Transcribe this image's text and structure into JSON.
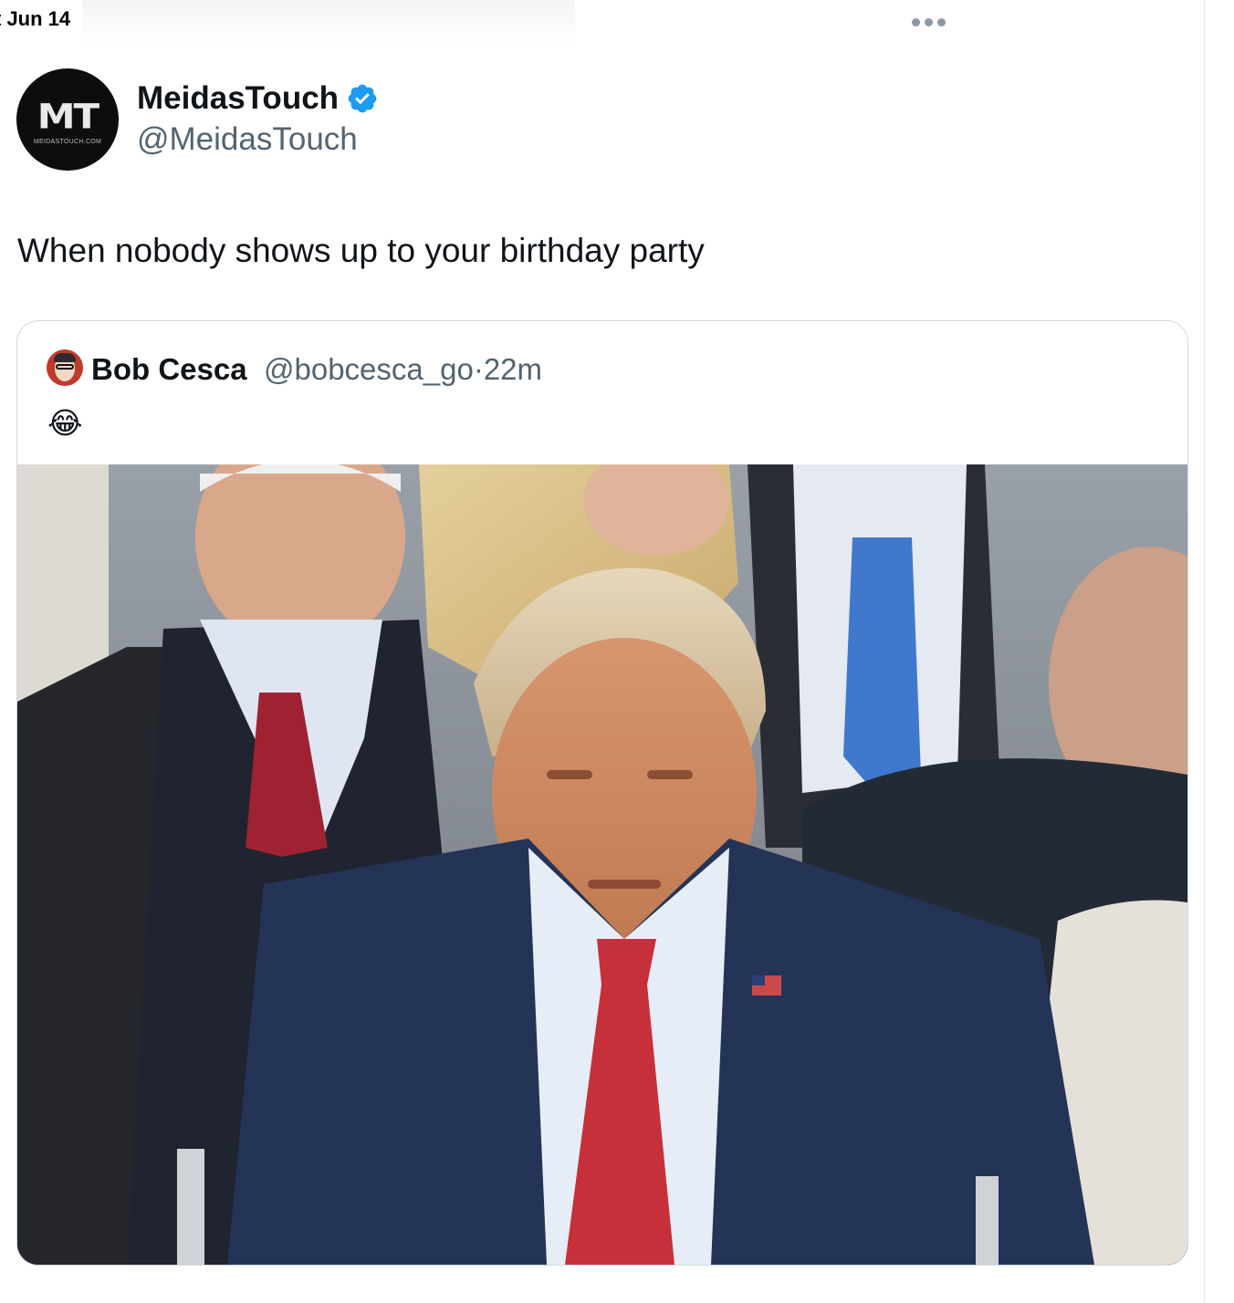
{
  "status_bar": {
    "date": "t Jun 14"
  },
  "post": {
    "author": {
      "display_name": "MeidasTouch",
      "handle": "@MeidasTouch",
      "verified": true,
      "avatar_monogram": "MT",
      "avatar_site_text": "MEIDASTOUCH.COM"
    },
    "text": "When nobody shows up to your birthday party",
    "more_icon": "more-horizontal-icon"
  },
  "quoted_post": {
    "author": {
      "display_name": "Bob Cesca",
      "handle": "@bobcesca_go",
      "separator": "·",
      "time": "22m"
    },
    "text": "😂",
    "media": "photo of Donald Trump in a navy suit and red tie seated at an outdoor event, with other attendees around him"
  },
  "colors": {
    "text_primary": "#0f1419",
    "text_secondary": "#536471",
    "verified_blue": "#1d9bf0",
    "card_border": "#cfd9de"
  }
}
